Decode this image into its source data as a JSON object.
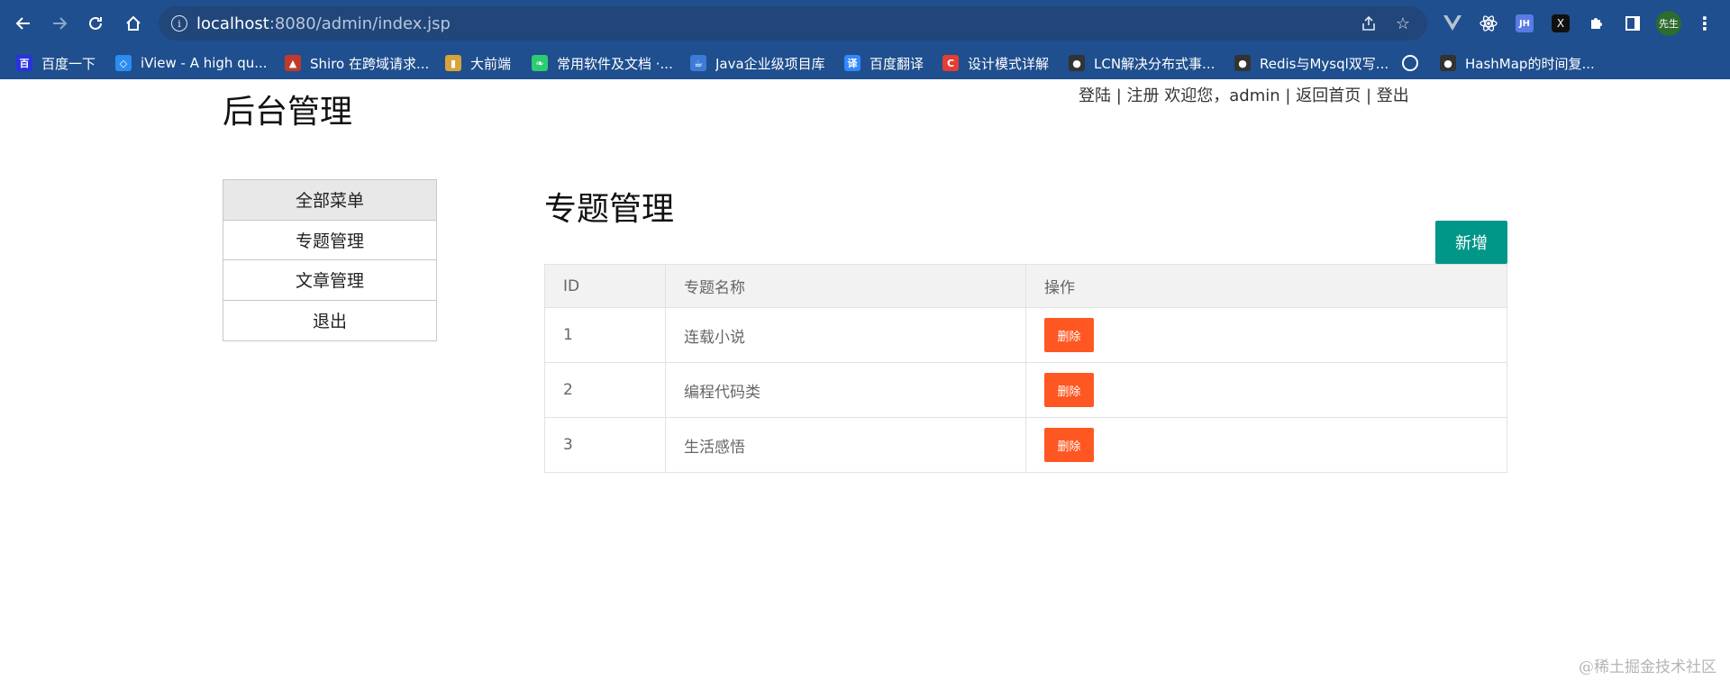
{
  "browser": {
    "url_host": "localhost",
    "url_rest": ":8080/admin/index.jsp",
    "avatar_text": "先生",
    "ext_jh": "JH",
    "ext_x": "X",
    "bookmarks": [
      {
        "label": "百度一下",
        "icon": "baidu-icon",
        "color": "#2932e1",
        "glyph": "百"
      },
      {
        "label": "iView - A high qu...",
        "icon": "iview-icon",
        "color": "#2d8cf0",
        "glyph": "◇"
      },
      {
        "label": "Shiro 在跨域请求...",
        "icon": "juejin-icon",
        "color": "#c0392b",
        "glyph": "▲"
      },
      {
        "label": "大前端",
        "icon": "book-icon",
        "color": "#d9a33a",
        "glyph": "▮"
      },
      {
        "label": "常用软件及文档 ·...",
        "icon": "leaf-icon",
        "color": "#2ecc71",
        "glyph": "❧"
      },
      {
        "label": "Java企业级项目库",
        "icon": "java-icon",
        "color": "#3d7bd9",
        "glyph": "☕"
      },
      {
        "label": "百度翻译",
        "icon": "translate-icon",
        "color": "#3388ff",
        "glyph": "译"
      },
      {
        "label": "设计模式详解",
        "icon": "csdn-icon",
        "color": "#e33e33",
        "glyph": "C"
      },
      {
        "label": "LCN解决分布式事...",
        "icon": "github-icon",
        "color": "#333333",
        "glyph": "●"
      },
      {
        "label": "Redis与Mysql双写...",
        "icon": "github-icon",
        "color": "#333333",
        "glyph": "●"
      },
      {
        "label": "",
        "icon": "globe-icon",
        "color": "#1f4f8e",
        "glyph": "🌐"
      },
      {
        "label": "HashMap的时间复...",
        "icon": "github-icon",
        "color": "#333333",
        "glyph": "●"
      }
    ]
  },
  "header": {
    "title": "后台管理",
    "login": "登陆",
    "register": "注册",
    "welcome": "欢迎您，admin",
    "back_home": "返回首页",
    "logout": "登出",
    "sep": "|"
  },
  "menu": {
    "items": [
      {
        "label": "全部菜单",
        "active": true
      },
      {
        "label": "专题管理",
        "active": false
      },
      {
        "label": "文章管理",
        "active": false
      },
      {
        "label": "退出",
        "active": false
      }
    ]
  },
  "main": {
    "title": "专题管理",
    "add_label": "新增",
    "columns": [
      "ID",
      "专题名称",
      "操作"
    ],
    "rows": [
      {
        "id": "1",
        "name": "连载小说",
        "action": "删除"
      },
      {
        "id": "2",
        "name": "编程代码类",
        "action": "删除"
      },
      {
        "id": "3",
        "name": "生活感悟",
        "action": "删除"
      }
    ]
  },
  "watermark": "@稀土掘金技术社区",
  "colors": {
    "chrome": "#1f4f8e",
    "add_button": "#009688",
    "delete_button": "#ff5722"
  }
}
